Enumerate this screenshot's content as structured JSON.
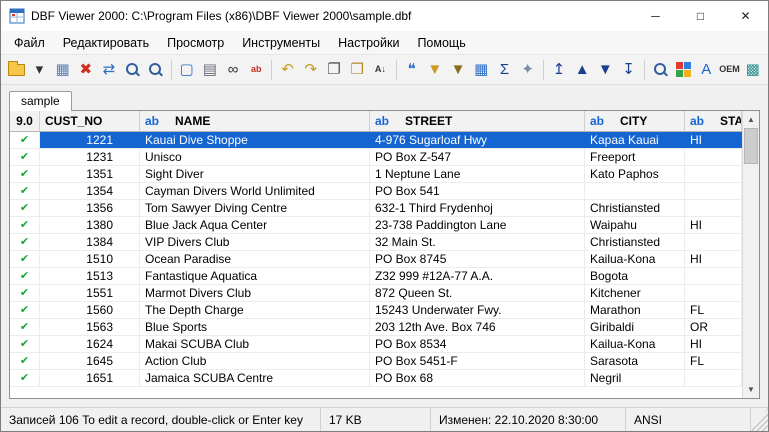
{
  "window": {
    "title": "DBF Viewer 2000: C:\\Program Files (x86)\\DBF Viewer 2000\\sample.dbf",
    "controls": {
      "minimize": "─",
      "maximize": "□",
      "close": "✕"
    }
  },
  "menu": {
    "items": [
      {
        "id": "file",
        "label": "Файл"
      },
      {
        "id": "edit",
        "label": "Редактировать"
      },
      {
        "id": "view",
        "label": "Просмотр"
      },
      {
        "id": "tools",
        "label": "Инструменты"
      },
      {
        "id": "options",
        "label": "Настройки"
      },
      {
        "id": "help",
        "label": "Помощь"
      }
    ]
  },
  "toolbar": {
    "items": [
      {
        "name": "open-file-button",
        "icon": "open-folder-icon",
        "type": "folder"
      },
      {
        "name": "open-recent-dropdown",
        "icon": "dropdown-arrow-icon",
        "glyph": "▾",
        "color": "#333333"
      },
      {
        "name": "save-button",
        "icon": "save-icon",
        "glyph": "▦",
        "color": "#5a7fb5"
      },
      {
        "name": "delete-record-button",
        "icon": "delete-icon",
        "glyph": "✖",
        "color": "#d22c1f"
      },
      {
        "name": "export-button",
        "icon": "export-icon",
        "glyph": "⇄",
        "color": "#2e6fc0"
      },
      {
        "name": "search-file-button",
        "icon": "search-file-icon",
        "type": "mag"
      },
      {
        "name": "zoom-button",
        "icon": "zoom-icon",
        "type": "mag"
      },
      {
        "type": "sep"
      },
      {
        "name": "form-view-button",
        "icon": "form-view-icon",
        "glyph": "▢",
        "color": "#2e6fc0"
      },
      {
        "name": "print-button",
        "icon": "print-icon",
        "glyph": "▤",
        "color": "#666677"
      },
      {
        "name": "find-button",
        "icon": "binoculars-icon",
        "glyph": "∞",
        "color": "#333333"
      },
      {
        "name": "replace-button",
        "icon": "replace-icon",
        "glyph": "ab",
        "color": "#c2311f"
      },
      {
        "type": "sep"
      },
      {
        "name": "undo-button",
        "icon": "undo-icon",
        "glyph": "↶",
        "color": "#c99a1f"
      },
      {
        "name": "redo-button",
        "icon": "redo-icon",
        "glyph": "↷",
        "color": "#c99a1f"
      },
      {
        "name": "copy-button",
        "icon": "copy-icon",
        "glyph": "❐",
        "color": "#555566"
      },
      {
        "name": "paste-button",
        "icon": "paste-icon",
        "glyph": "❒",
        "color": "#b58a2e"
      },
      {
        "name": "sort-button",
        "icon": "sort-icon",
        "glyph": "A↓",
        "color": "#333333"
      },
      {
        "type": "sep"
      },
      {
        "name": "comment-button",
        "icon": "comment-icon",
        "glyph": "❝",
        "color": "#2e6fc0"
      },
      {
        "name": "filter-button",
        "icon": "filter-icon",
        "glyph": "▼",
        "color": "#c99a1f"
      },
      {
        "name": "advanced-filter-button",
        "icon": "advanced-filter-icon",
        "glyph": "▼",
        "color": "#8a6d1a"
      },
      {
        "name": "grid-view-button",
        "icon": "grid-icon",
        "glyph": "▦",
        "color": "#2e6fc0"
      },
      {
        "name": "sum-button",
        "icon": "sum-icon",
        "glyph": "Σ",
        "color": "#1a3f8f"
      },
      {
        "name": "clear-button",
        "icon": "eraser-icon",
        "glyph": "✦",
        "color": "#7a8ba8"
      },
      {
        "type": "sep"
      },
      {
        "name": "first-record-button",
        "icon": "first-record-icon",
        "glyph": "↥",
        "color": "#1a3f8f"
      },
      {
        "name": "prev-record-button",
        "icon": "prev-record-icon",
        "glyph": "▲",
        "color": "#1a3f8f"
      },
      {
        "name": "next-record-button",
        "icon": "next-record-icon",
        "glyph": "▼",
        "color": "#1a3f8f"
      },
      {
        "name": "last-record-button",
        "icon": "last-record-icon",
        "glyph": "↧",
        "color": "#1a3f8f"
      },
      {
        "type": "sep"
      },
      {
        "name": "goto-record-button",
        "icon": "goto-icon",
        "type": "mag"
      },
      {
        "name": "codepage-button",
        "icon": "codepage-icon",
        "type": "cubes"
      },
      {
        "name": "font-button",
        "icon": "font-icon",
        "glyph": "A",
        "color": "#1a62d2"
      },
      {
        "name": "oem-button",
        "icon": "oem-icon",
        "glyph": "OEM",
        "color": "#333333"
      },
      {
        "name": "settings-button",
        "icon": "settings-icon",
        "glyph": "▩",
        "color": "#2e8f8f"
      }
    ]
  },
  "tabs": [
    {
      "label": "sample"
    }
  ],
  "table": {
    "version_header": "9.0",
    "check_glyph": "✔",
    "columns": [
      {
        "label": "CUST_NO",
        "type": ""
      },
      {
        "label": "NAME",
        "type": "ab"
      },
      {
        "label": "STREET",
        "type": "ab"
      },
      {
        "label": "CITY",
        "type": "ab"
      },
      {
        "label": "STATE",
        "type": "ab"
      }
    ],
    "rows": [
      {
        "selected": true,
        "cust_no": "1221",
        "name": "Kauai Dive Shoppe",
        "street": "4-976 Sugarloaf Hwy",
        "city": "Kapaa Kauai",
        "state": "HI"
      },
      {
        "cust_no": "1231",
        "name": "Unisco",
        "street": "PO Box Z-547",
        "city": "Freeport",
        "state": ""
      },
      {
        "cust_no": "1351",
        "name": "Sight Diver",
        "street": "1 Neptune Lane",
        "city": "Kato Paphos",
        "state": ""
      },
      {
        "cust_no": "1354",
        "name": "Cayman Divers World Unlimited",
        "street": "PO Box 541",
        "city": "",
        "state": ""
      },
      {
        "cust_no": "1356",
        "name": "Tom Sawyer Diving Centre",
        "street": "632-1 Third Frydenhoj",
        "city": "Christiansted",
        "state": ""
      },
      {
        "cust_no": "1380",
        "name": "Blue Jack Aqua Center",
        "street": "23-738 Paddington Lane",
        "city": "Waipahu",
        "state": "HI"
      },
      {
        "cust_no": "1384",
        "name": "VIP Divers Club",
        "street": "32 Main St.",
        "city": "Christiansted",
        "state": ""
      },
      {
        "cust_no": "1510",
        "name": "Ocean Paradise",
        "street": "PO Box 8745",
        "city": "Kailua-Kona",
        "state": "HI"
      },
      {
        "cust_no": "1513",
        "name": "Fantastique Aquatica",
        "street": "Z32 999 #12A-77 A.A.",
        "city": "Bogota",
        "state": ""
      },
      {
        "cust_no": "1551",
        "name": "Marmot Divers Club",
        "street": "872 Queen St.",
        "city": "Kitchener",
        "state": ""
      },
      {
        "cust_no": "1560",
        "name": "The Depth Charge",
        "street": "15243 Underwater Fwy.",
        "city": "Marathon",
        "state": "FL"
      },
      {
        "cust_no": "1563",
        "name": "Blue Sports",
        "street": "203 12th Ave. Box 746",
        "city": "Giribaldi",
        "state": "OR"
      },
      {
        "cust_no": "1624",
        "name": "Makai SCUBA Club",
        "street": "PO Box 8534",
        "city": "Kailua-Kona",
        "state": "HI"
      },
      {
        "cust_no": "1645",
        "name": "Action Club",
        "street": "PO Box 5451-F",
        "city": "Sarasota",
        "state": "FL"
      },
      {
        "cust_no": "1651",
        "name": "Jamaica SCUBA Centre",
        "street": "PO Box 68",
        "city": "Negril",
        "state": ""
      }
    ]
  },
  "scrollbar": {
    "up": "▲",
    "down": "▼"
  },
  "statusbar": {
    "records": "Записей 106 To edit a record, double-click or Enter key",
    "size": "17 KB",
    "modified": "Изменен: 22.10.2020 8:30:00",
    "encoding": "ANSI"
  }
}
